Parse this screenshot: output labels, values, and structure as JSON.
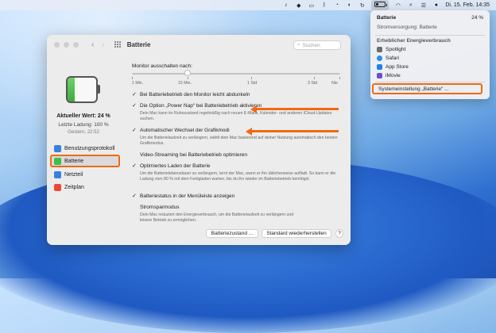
{
  "menubar": {
    "clock": "Di. 15. Feb.  14:35",
    "battery_level": 0.24
  },
  "window": {
    "title": "Batterie",
    "search_placeholder": "Suchen",
    "nav_back": "‹",
    "nav_forward": "›"
  },
  "sidebar": {
    "battery_level": 0.24,
    "current_value": "Aktueller Wert: 24 %",
    "last_charge": "Letzte Ladung: 100 %",
    "last_time": "Gestern, 22:52",
    "items": [
      {
        "label": "Benutzungsprotokoll",
        "icon": "chart-icon",
        "color": "#3a7fe0"
      },
      {
        "label": "Batterie",
        "icon": "battery-icon",
        "color": "#3cbf4a"
      },
      {
        "label": "Netzteil",
        "icon": "power-adapter-icon",
        "color": "#3a7fe0"
      },
      {
        "label": "Zeitplan",
        "icon": "calendar-icon",
        "color": "#e94a3b"
      }
    ]
  },
  "main": {
    "monitor_label": "Monitor ausschalten nach:",
    "slider_value": "10 Min.",
    "ticks": [
      "1 Min.",
      "15 Min.",
      "1 Std",
      "3 Std",
      "Nie"
    ],
    "options": [
      {
        "label": "Bei Batteriebetrieb den Monitor leicht abdunkeln",
        "checked": true,
        "desc": ""
      },
      {
        "label": "Die Option „Power Nap“ bei Batteriebetrieb aktivieren",
        "checked": true,
        "desc": "Dein Mac kann im Ruhezustand regelmäßig nach neuen E-Mails, Kalender- und anderen iCloud-Updates suchen."
      },
      {
        "label": "Automatischer Wechsel der Grafikmodi",
        "checked": true,
        "desc": "Um die Batterielaufzeit zu verlängern, wählt dein Mac basierend auf deiner Nutzung automatisch den besten Grafikmodus."
      },
      {
        "label": "Video-Streaming bei Batteriebetrieb optimieren",
        "checked": false,
        "desc": ""
      },
      {
        "label": "Optimiertes Laden der Batterie",
        "checked": true,
        "desc": "Um die Batterielebensdauer zu verlängern, lernt der Mac, wann er ihn üblicherweise auflädt. So kann er die Ladung vom 80 % mit dem Fertigladen warten, bis du ihn wieder im Batteriebetrieb benötigst."
      },
      {
        "label": "Batteriestatus in der Menüleiste anzeigen",
        "checked": true,
        "desc": ""
      },
      {
        "label": "Stromsparmodus",
        "checked": false,
        "desc": "Dein Mac reduziert den Energieverbrauch, um die Batterielaufzeit zu verlängern und leisere Betrieb zu ermöglichen."
      }
    ],
    "btn_battery_state": "Batteriezustand ...",
    "btn_defaults": "Standard wiederherstellen",
    "btn_help": "?"
  },
  "menu": {
    "title": "Batterie",
    "percent": "24 %",
    "source": "Stromversorgung: Batterie",
    "heavy_label": "Erheblicher Energieverbrauch",
    "apps": [
      {
        "name": "Spotlight",
        "icon": "search-icon",
        "color": "#6d6d6d"
      },
      {
        "name": "Safari",
        "icon": "compass-icon",
        "color": "#2a8cf0"
      },
      {
        "name": "App Store",
        "icon": "app-store-icon",
        "color": "#1f7ff0"
      },
      {
        "name": "iMovie",
        "icon": "star-icon",
        "color": "#6a4fd0"
      }
    ],
    "settings": "Systemeinstellung „Batterie“ ..."
  },
  "accent": "#f06a12"
}
